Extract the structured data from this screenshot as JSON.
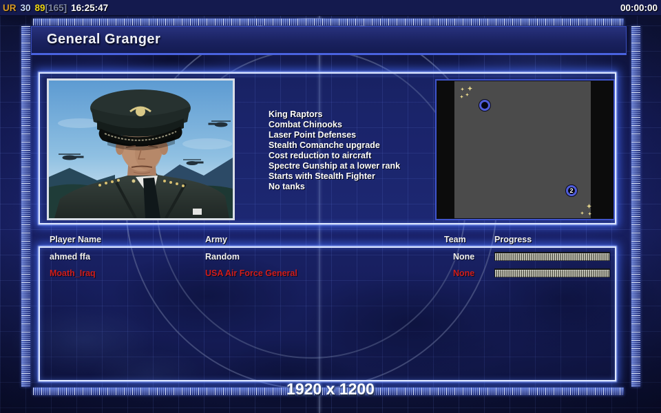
{
  "top_bar": {
    "stats": [
      {
        "text": "UR",
        "color": "#d99a26"
      },
      {
        "text": "30",
        "color": "#c7d9f7"
      },
      {
        "text": "89",
        "color": "#efd714"
      },
      {
        "text": "[165]",
        "color": "#7d86a0"
      },
      {
        "text": "16:25:47",
        "color": "#ffffff"
      }
    ],
    "match_timer": "00:00:00"
  },
  "title_bar": {
    "title": "General Granger"
  },
  "general_panel": {
    "features": [
      "King Raptors",
      "Combat Chinooks",
      "Laser Point Defenses",
      "Stealth Comanche upgrade",
      "Cost reduction to aircraft",
      "Spectre Gunship at a lower rank",
      "Starts with Stealth Fighter",
      "No tanks"
    ]
  },
  "minimap": {
    "markers": [
      {
        "number": ""
      },
      {
        "number": "2"
      }
    ],
    "marker_ring_color": "#4f5cd8",
    "star_color": "#ead98e"
  },
  "player_table": {
    "headers": {
      "name": "Player Name",
      "army": "Army",
      "team": "Team",
      "progress": "Progress"
    },
    "rows": [
      {
        "name": "ahmed ffa",
        "army": "Random",
        "team": "None",
        "progress_percent": 100,
        "color": "#f2f2f2"
      },
      {
        "name": "Moath_Iraq",
        "army": "USA Air Force General",
        "team": "None",
        "progress_percent": 100,
        "color": "#cf1d1d"
      }
    ]
  },
  "footer": {
    "resolution": "1920 x 1200"
  }
}
